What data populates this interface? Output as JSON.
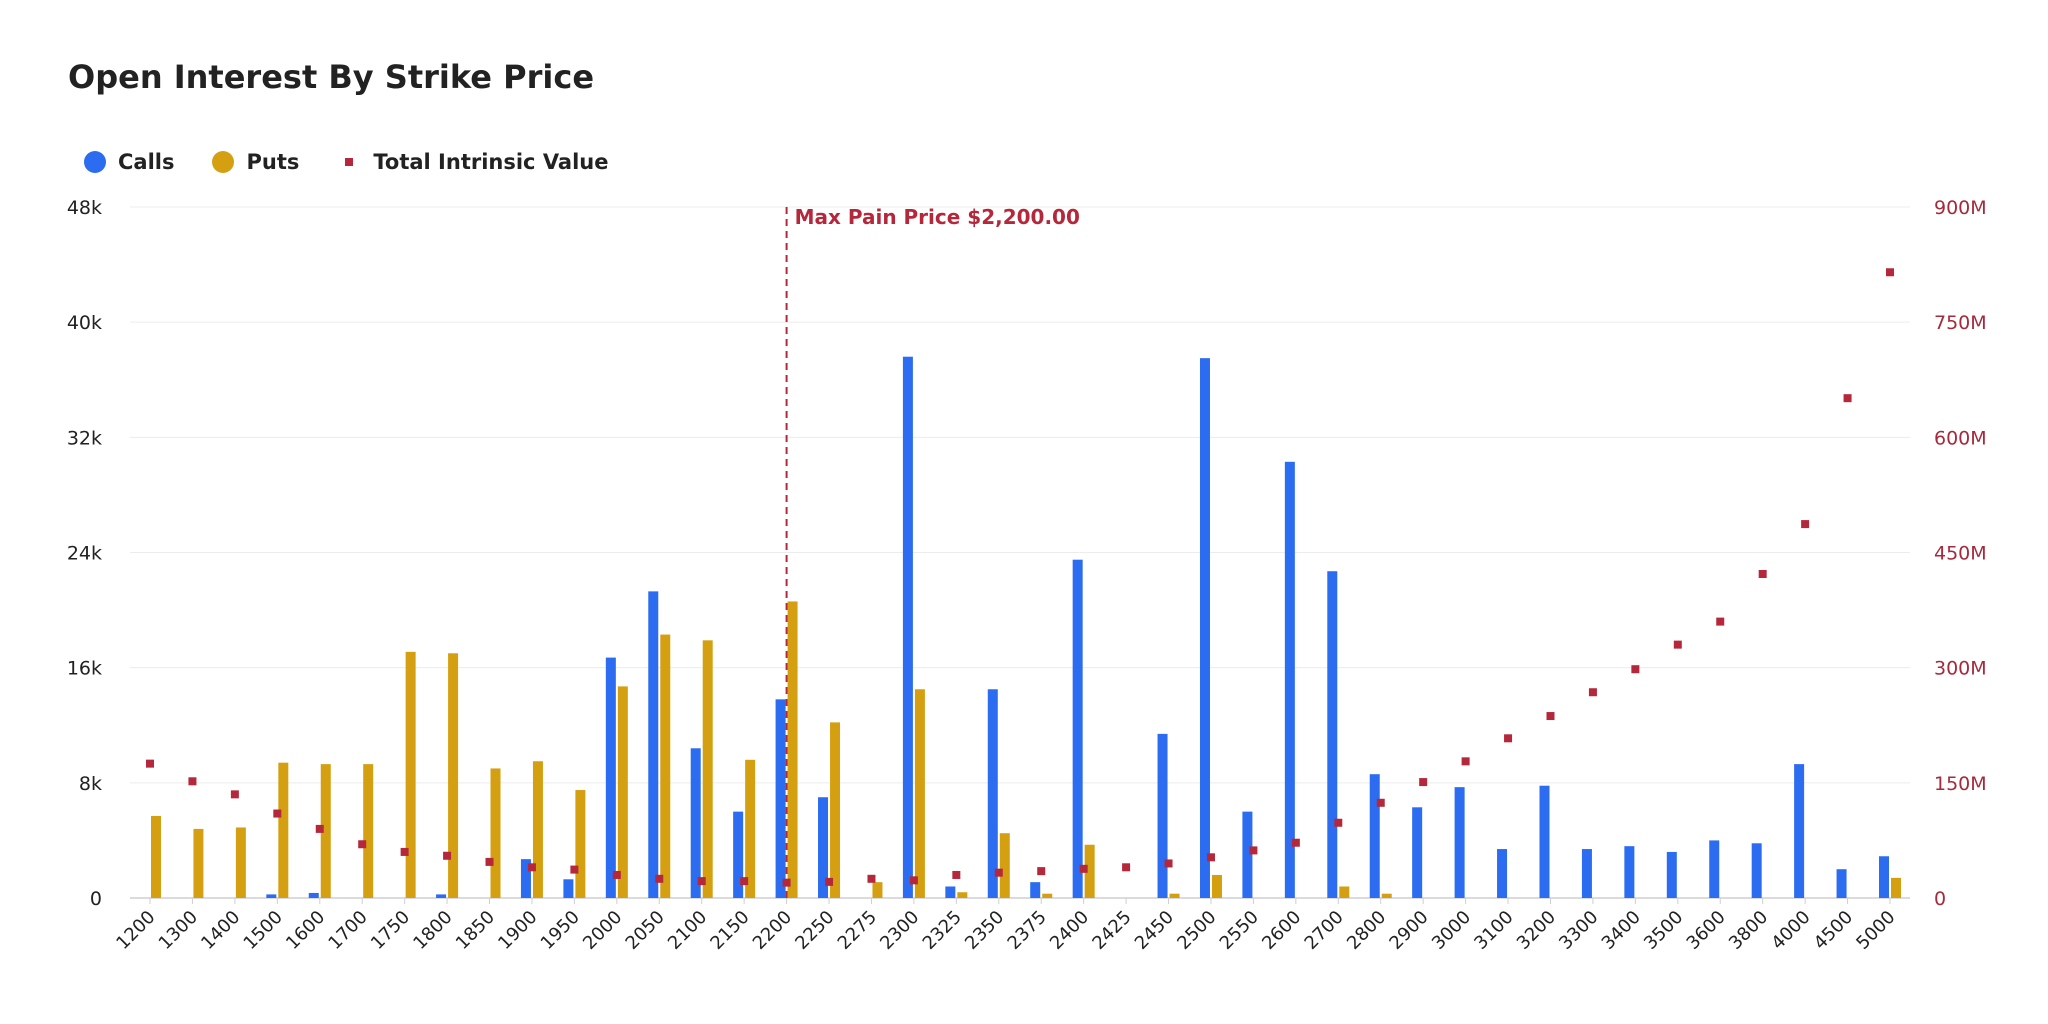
{
  "chart_data": {
    "type": "bar",
    "title": "Open Interest By Strike Price",
    "categories": [
      "1200",
      "1300",
      "1400",
      "1500",
      "1600",
      "1700",
      "1750",
      "1800",
      "1850",
      "1900",
      "1950",
      "2000",
      "2050",
      "2100",
      "2150",
      "2200",
      "2250",
      "2275",
      "2300",
      "2325",
      "2350",
      "2375",
      "2400",
      "2425",
      "2450",
      "2500",
      "2550",
      "2600",
      "2700",
      "2800",
      "2900",
      "3000",
      "3100",
      "3200",
      "3300",
      "3400",
      "3500",
      "3600",
      "3800",
      "4000",
      "4500",
      "5000"
    ],
    "series": [
      {
        "name": "Calls",
        "axis": "left",
        "color": "#2b6cf0",
        "values": [
          0,
          0,
          0,
          250,
          350,
          0,
          0,
          250,
          0,
          2700,
          1300,
          16700,
          21300,
          10400,
          6000,
          13800,
          7000,
          0,
          37600,
          800,
          14500,
          1100,
          23500,
          0,
          11400,
          37500,
          6000,
          30300,
          22700,
          8600,
          6300,
          7700,
          3400,
          7800,
          3400,
          3600,
          3200,
          4000,
          3800,
          9300,
          2000,
          2900
        ]
      },
      {
        "name": "Puts",
        "axis": "left",
        "color": "#d4a012",
        "values": [
          5700,
          4800,
          4900,
          9400,
          9300,
          9300,
          17100,
          17000,
          9000,
          9500,
          7500,
          14700,
          18300,
          17900,
          9600,
          20600,
          12200,
          1100,
          14500,
          400,
          4500,
          300,
          3700,
          0,
          300,
          1600,
          0,
          0,
          800,
          300,
          0,
          0,
          0,
          0,
          0,
          0,
          0,
          0,
          0,
          0,
          0,
          1400
        ]
      },
      {
        "name": "Total Intrinsic Value",
        "axis": "right",
        "color": "#b5283b",
        "style": "marker",
        "values": [
          175,
          152,
          135,
          110,
          90,
          70,
          60,
          55,
          47,
          40,
          37,
          30,
          25,
          22,
          22,
          20,
          21,
          25,
          23,
          30,
          33,
          35,
          38,
          40,
          45,
          53,
          62,
          72,
          98,
          124,
          151,
          178,
          208,
          237,
          268,
          298,
          330,
          360,
          422,
          487,
          651,
          815
        ]
      }
    ],
    "left_axis": {
      "ylim": [
        0,
        48000
      ],
      "ticks": [
        0,
        8000,
        16000,
        24000,
        32000,
        40000,
        48000
      ],
      "tick_labels": [
        "0",
        "8k",
        "16k",
        "24k",
        "32k",
        "40k",
        "48k"
      ]
    },
    "right_axis": {
      "ylim": [
        0,
        900
      ],
      "unit": "M",
      "ticks": [
        0,
        150,
        300,
        450,
        600,
        750,
        900
      ],
      "tick_labels": [
        "0",
        "150M",
        "300M",
        "450M",
        "600M",
        "750M",
        "900M"
      ]
    },
    "annotation": {
      "category": "2200",
      "label": "Max Pain Price $2,200.00"
    },
    "grid": true,
    "legend": {
      "position": "top-left",
      "items": [
        "Calls",
        "Puts",
        "Total Intrinsic Value"
      ]
    }
  }
}
